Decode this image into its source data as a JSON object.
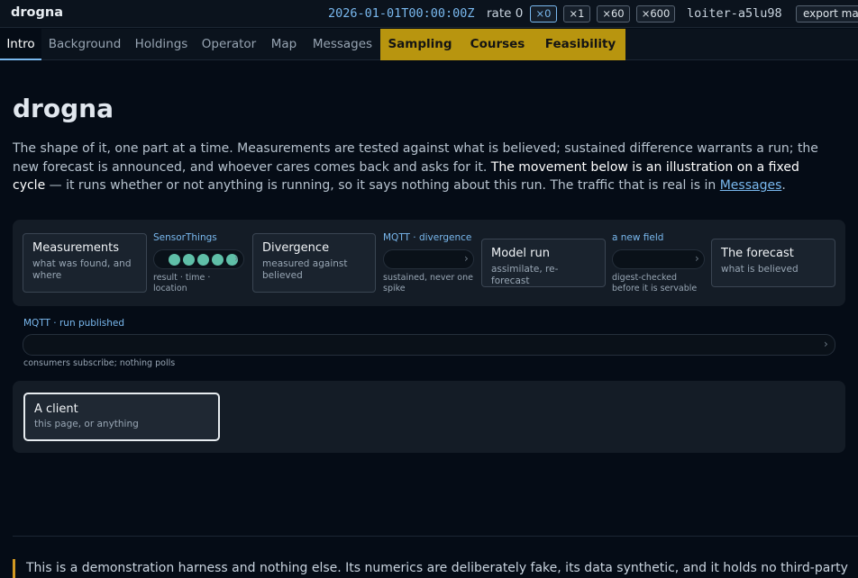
{
  "app": {
    "title": "drogna"
  },
  "header": {
    "clock": "2026-01-01T00:00:00Z",
    "rate_label": "rate 0",
    "rate_buttons": [
      "×0",
      "×1",
      "×60",
      "×600"
    ],
    "active_rate": "×0",
    "session_id": "loiter-a5lu98",
    "export_label": "export manifest"
  },
  "tabs": [
    {
      "label": "Intro",
      "state": "active"
    },
    {
      "label": "Background"
    },
    {
      "label": "Holdings"
    },
    {
      "label": "Operator"
    },
    {
      "label": "Map"
    },
    {
      "label": "Messages"
    },
    {
      "label": "Sampling",
      "state": "highlighted"
    },
    {
      "label": "Courses",
      "state": "highlighted"
    },
    {
      "label": "Feasibility",
      "state": "highlighted"
    }
  ],
  "colors": {
    "accent": "#79b8ee",
    "highlight_tab": "#b8950f",
    "dot": "#5fbfa8",
    "disclaimer_bar": "#d29922"
  },
  "main": {
    "title": "drogna",
    "intro_part1": "The shape of it, one part at a time. Measurements are tested against what is believed; sustained difference warrants a run; the new forecast is announced, and whoever cares comes back and asks for it. ",
    "intro_emphasis": "The movement below is an illustration on a fixed cycle",
    "intro_part2": " — it runs whether or not anything is running, so it says nothing about this run. The traffic that is real is in ",
    "intro_link": "Messages",
    "intro_end": "."
  },
  "pipeline": {
    "nodes": [
      {
        "title": "Measurements",
        "sub": "what was found, and where"
      },
      {
        "title": "Divergence",
        "sub": "measured against believed"
      },
      {
        "title": "Model run",
        "sub": "assimilate, re-forecast"
      },
      {
        "title": "The forecast",
        "sub": "what is believed"
      }
    ],
    "connectors": [
      {
        "label": "SensorThings",
        "note": "result · time · location",
        "dots": 5,
        "chevron": "›"
      },
      {
        "label": "MQTT · divergence",
        "note": "sustained, never one spike",
        "chevron": "›"
      },
      {
        "label": "a new field",
        "note": "digest-checked before it is servable",
        "chevron": "›"
      }
    ],
    "bus": {
      "label": "MQTT · run published",
      "note": "consumers subscribe; nothing polls",
      "chevron": "›"
    },
    "client": {
      "title": "A client",
      "sub": "this page, or anything"
    }
  },
  "footer": {
    "disclaimer": "This is a demonstration harness and nothing else. Its numerics are deliberately fake, its data synthetic, and it holds no third-party"
  }
}
